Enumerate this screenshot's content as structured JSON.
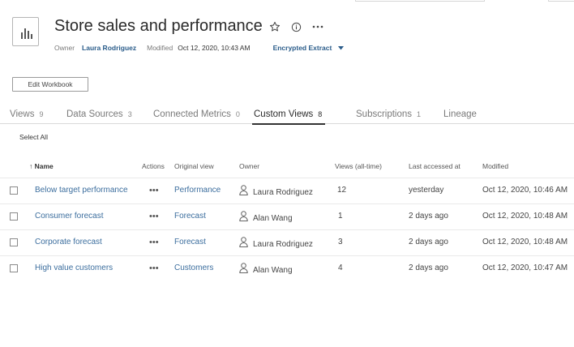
{
  "header": {
    "title": "Store sales and performance",
    "owner_label": "Owner",
    "owner_name": "Laura Rodriguez",
    "modified_label": "Modified",
    "modified_value": "Oct 12, 2020, 10:43 AM",
    "extract_label": "Encrypted Extract",
    "icons": [
      "workbook-icon",
      "star-icon",
      "info-icon",
      "more-icon",
      "caret-down-icon"
    ]
  },
  "toolbar": {
    "edit_workbook_label": "Edit Workbook"
  },
  "tabs": [
    {
      "label": "Views",
      "count": "9"
    },
    {
      "label": "Data Sources",
      "count": "3"
    },
    {
      "label": "Connected Metrics",
      "count": "0"
    },
    {
      "label": "Custom Views",
      "count": "8",
      "active": true
    },
    {
      "label": "Subscriptions",
      "count": "1"
    },
    {
      "label": "Lineage",
      "count": ""
    }
  ],
  "list": {
    "select_all_label": "Select All",
    "sort_indicator": "↑",
    "columns": {
      "name": "Name",
      "actions": "Actions",
      "original_view": "Original view",
      "owner": "Owner",
      "views": "Views (all-time)",
      "last_accessed": "Last accessed at",
      "modified": "Modified"
    },
    "actions_glyph": "•••",
    "rows": [
      {
        "name": "Below target performance",
        "original_view": "Performance",
        "owner": "Laura Rodriguez",
        "views": "12",
        "last_accessed": "yesterday",
        "modified": "Oct 12, 2020, 10:46 AM"
      },
      {
        "name": "Consumer forecast",
        "original_view": "Forecast",
        "owner": "Alan Wang",
        "views": "1",
        "last_accessed": "2 days ago",
        "modified": "Oct 12, 2020, 10:48 AM"
      },
      {
        "name": "Corporate forecast",
        "original_view": "Forecast",
        "owner": "Laura Rodriguez",
        "views": "3",
        "last_accessed": "2 days ago",
        "modified": "Oct 12, 2020, 10:48 AM"
      },
      {
        "name": "High value customers",
        "original_view": "Customers",
        "owner": "Alan Wang",
        "views": "4",
        "last_accessed": "2 days ago",
        "modified": "Oct 12, 2020, 10:47 AM"
      }
    ]
  },
  "colors": {
    "link": "#3c6e9e",
    "owner_link": "#2a5c8a",
    "active_tab_underline": "#333333",
    "divider": "#d9d9d9"
  }
}
